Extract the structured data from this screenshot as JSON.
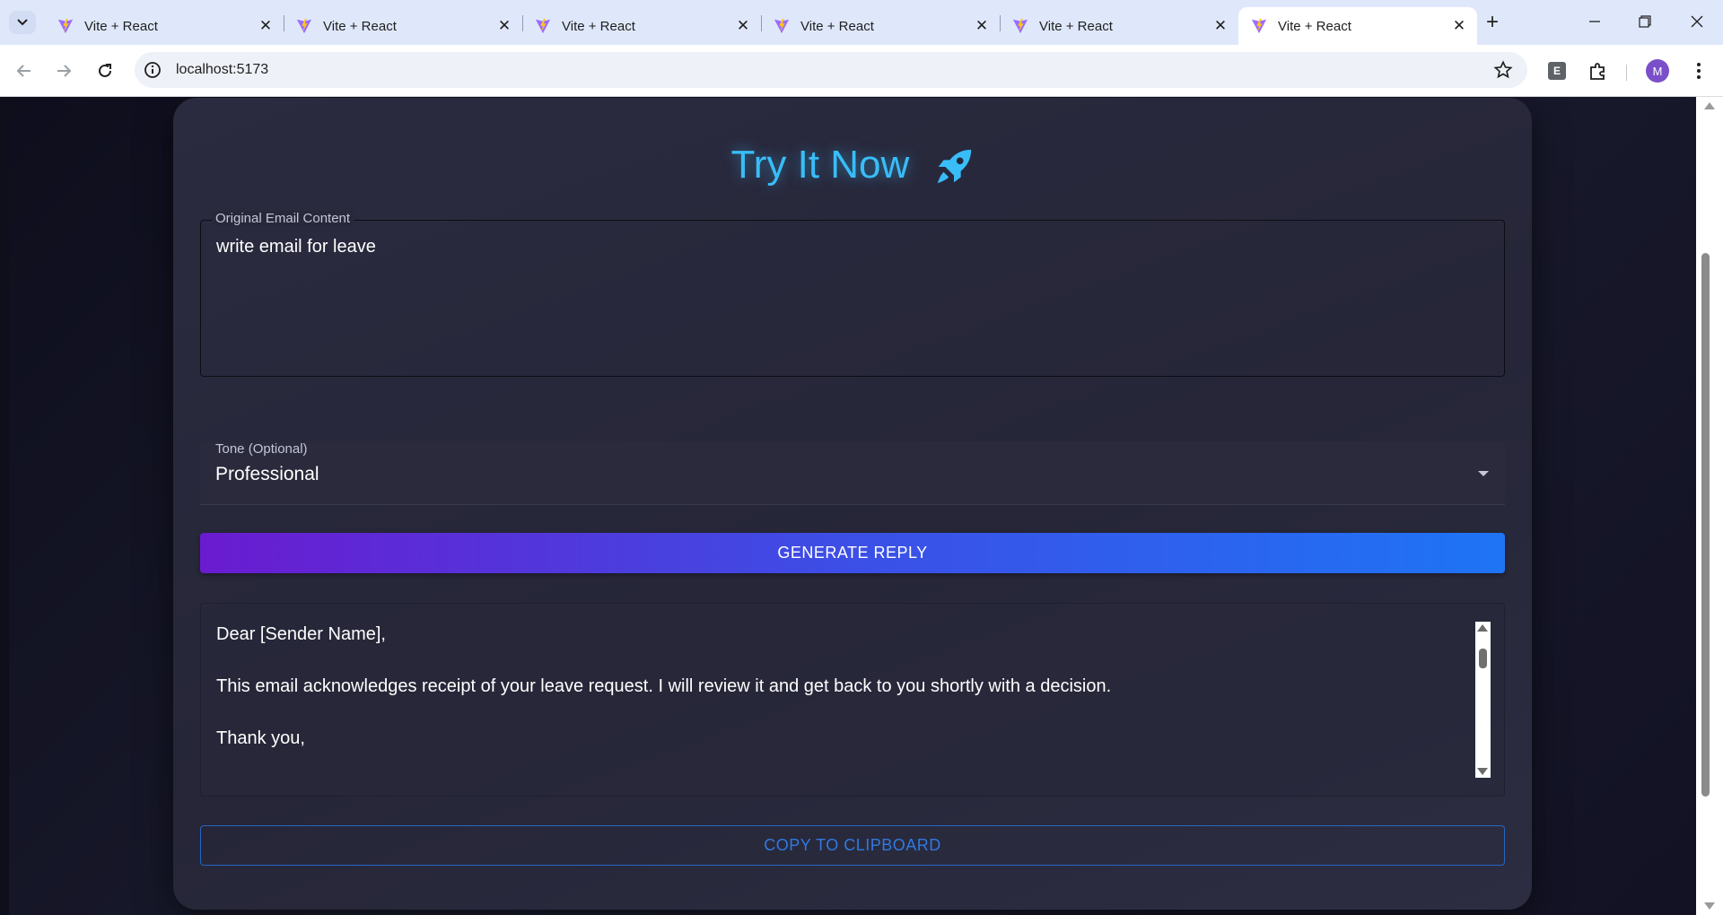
{
  "browser": {
    "tabs": [
      {
        "title": "Vite + React",
        "active": false
      },
      {
        "title": "Vite + React",
        "active": false
      },
      {
        "title": "Vite + React",
        "active": false
      },
      {
        "title": "Vite + React",
        "active": false
      },
      {
        "title": "Vite + React",
        "active": false
      },
      {
        "title": "Vite + React",
        "active": true
      }
    ],
    "url": "localhost:5173",
    "extension_label": "E",
    "profile_initial": "M",
    "icons": [
      "tab-search-icon",
      "vite-favicon-icon",
      "close-icon",
      "new-tab-icon",
      "minimize-icon",
      "restore-icon",
      "window-close-icon",
      "back-icon",
      "forward-icon",
      "reload-icon",
      "site-info-icon",
      "bookmark-star-icon",
      "extensions-puzzle-icon",
      "menu-kebab-icon"
    ]
  },
  "page": {
    "title": "Try It Now",
    "title_icon": "rocket-icon",
    "email_field": {
      "label": "Original Email Content",
      "value": "write email for leave"
    },
    "tone_select": {
      "label": "Tone (Optional)",
      "selected": "Professional"
    },
    "generate_button": "GENERATE REPLY",
    "reply": {
      "line1": "Dear [Sender Name],",
      "line2": "This email acknowledges receipt of your leave request. I will review it and get back to you shortly with a decision.",
      "line3": "Thank you,"
    },
    "copy_button": "COPY TO CLIPBOARD"
  },
  "colors": {
    "accent_title": "#38bdf8",
    "button_gradient_start": "#6a1bd0",
    "button_gradient_end": "#1e74f5",
    "copy_border": "#2566c4",
    "card_bg": "#2b2b40"
  }
}
